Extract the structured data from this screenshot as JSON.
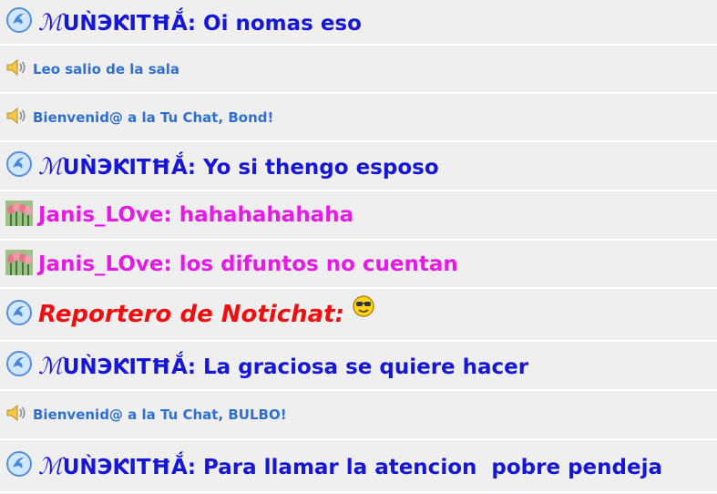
{
  "messages": [
    {
      "kind": "user",
      "icon": "dolphin-icon",
      "nick_script": "ℳ",
      "nick": "UǸЭƘITĦẮ",
      "sep": ": ",
      "text": "Oi nomas eso",
      "color": "#1616d6"
    },
    {
      "kind": "system",
      "icon": "speaker-icon",
      "text": "Leo salio de la sala"
    },
    {
      "kind": "system",
      "icon": "speaker-icon",
      "text": "Bienvenid@ a la Tu Chat, Bond!"
    },
    {
      "kind": "user",
      "icon": "dolphin-icon",
      "nick_script": "ℳ",
      "nick": "UǸЭƘITĦẮ",
      "sep": ": ",
      "text": "Yo si thengo esposo",
      "color": "#1616d6"
    },
    {
      "kind": "user",
      "icon": "tulips-icon",
      "nick": "Janis_LOve",
      "sep": ": ",
      "text": "hahahahahaha",
      "color": "#e61ae6"
    },
    {
      "kind": "user",
      "icon": "tulips-icon",
      "nick": "Janis_LOve",
      "sep": ": ",
      "text": "los difuntos no cuentan",
      "color": "#e61ae6"
    },
    {
      "kind": "user",
      "icon": "dolphin-icon",
      "nick": "Reportero de Notichat:",
      "text": "",
      "emoji": "sunglasses-smiley-icon",
      "color": "#ee1010"
    },
    {
      "kind": "user",
      "icon": "dolphin-icon",
      "nick_script": "ℳ",
      "nick": "UǸЭƘITĦẮ",
      "sep": ": ",
      "text": "La graciosa se quiere hacer",
      "color": "#1616d6"
    },
    {
      "kind": "system",
      "icon": "speaker-icon",
      "text": "Bienvenid@ a la Tu Chat, BULBO!"
    },
    {
      "kind": "user",
      "icon": "dolphin-icon",
      "nick_script": "ℳ",
      "nick": "UǸЭƘITĦẮ",
      "sep": ": ",
      "text": "Para llamar la atencion  pobre pendeja",
      "color": "#1616d6"
    }
  ]
}
